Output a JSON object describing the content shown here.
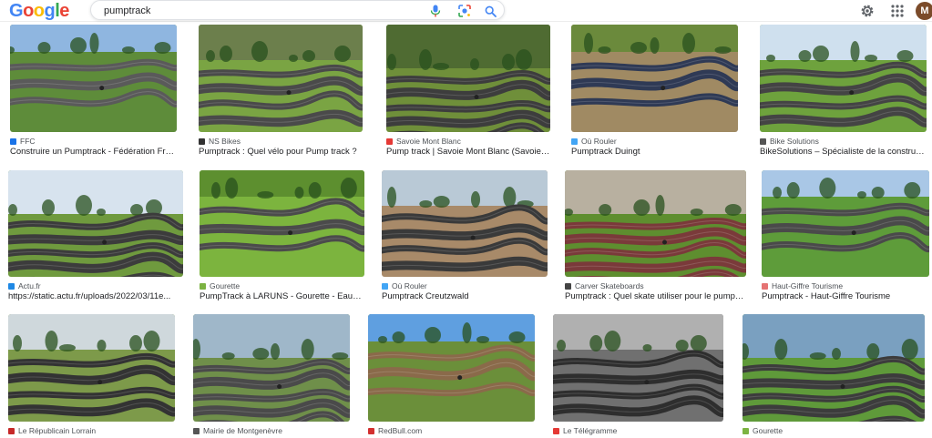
{
  "header": {
    "logo_letters": [
      {
        "char": "G",
        "color": "#4285F4"
      },
      {
        "char": "o",
        "color": "#EA4335"
      },
      {
        "char": "o",
        "color": "#FBBC05"
      },
      {
        "char": "g",
        "color": "#4285F4"
      },
      {
        "char": "l",
        "color": "#34A853"
      },
      {
        "char": "e",
        "color": "#EA4335"
      }
    ],
    "search_value": "pumptrack",
    "avatar_letter": "M",
    "icons": [
      "mic-icon",
      "lens-icon",
      "search-icon",
      "settings-icon",
      "apps-icon"
    ]
  },
  "results": [
    {
      "source": "FFC",
      "title": "Construire un Pumptrack - Fédération Fran...",
      "favicon": "#1a73e8",
      "sky": "#8fb6e0",
      "ground": "#5e8c3a",
      "track": "#5a5a5a"
    },
    {
      "source": "NS Bikes",
      "title": "Pumptrack : Quel vélo pour Pump track ?",
      "favicon": "#333333",
      "sky": "#6c7f4c",
      "ground": "#7aa443",
      "track": "#4a4a4a"
    },
    {
      "source": "Savoie Mont Blanc",
      "title": "Pump track | Savoie Mont Blanc (Savoie et ...",
      "favicon": "#e53935",
      "sky": "#4f6b32",
      "ground": "#6f8f3a",
      "track": "#3d3d3d"
    },
    {
      "source": "Où Rouler",
      "title": "Pumptrack Duingt",
      "favicon": "#42a5f5",
      "sky": "#6b8a3c",
      "ground": "#a08a63",
      "track": "#2f3a55"
    },
    {
      "source": "Bike Solutions",
      "title": "BikeSolutions – Spécialiste de la constructi...",
      "favicon": "#555555",
      "sky": "#cfe0ee",
      "ground": "#6ea23d",
      "track": "#444444"
    },
    {
      "source": "Actu.fr",
      "title": "https://static.actu.fr/uploads/2022/03/11e...",
      "favicon": "#1e88e5",
      "sky": "#d7e3ee",
      "ground": "#6f9a3e",
      "track": "#3c3c3c"
    },
    {
      "source": "Gourette",
      "title": "PumpTrack à LARUNS - Gourette - Eaux-B...",
      "favicon": "#7cb342",
      "sky": "#5d8f2f",
      "ground": "#7cb43e",
      "track": "#4b4b4b"
    },
    {
      "source": "Où Rouler",
      "title": "Pumptrack Creutzwald",
      "favicon": "#42a5f5",
      "sky": "#b9c9d6",
      "ground": "#a88a69",
      "track": "#3a3a3a"
    },
    {
      "source": "Carver Skateboards",
      "title": "Pumptrack : Quel skate utiliser pour le pump t...",
      "favicon": "#444444",
      "sky": "#b8b0a0",
      "ground": "#5e8e2f",
      "track": "#7a3a3a"
    },
    {
      "source": "Haut-Giffre Tourisme",
      "title": "Pumptrack - Haut-Giffre Tourisme",
      "favicon": "#e57373",
      "sky": "#a9c7e6",
      "ground": "#5e9c3a",
      "track": "#4a4a4a"
    },
    {
      "source": "Le Républicain Lorrain",
      "title": "",
      "favicon": "#c62828",
      "sky": "#cfd8dc",
      "ground": "#7d9a4a",
      "track": "#333333"
    },
    {
      "source": "Mairie de Montgenèvre",
      "title": "",
      "favicon": "#555555",
      "sky": "#9fb7c9",
      "ground": "#6f8f4a",
      "track": "#4a4a4a"
    },
    {
      "source": "RedBull.com",
      "title": "",
      "favicon": "#d32f2f",
      "sky": "#5f9fe0",
      "ground": "#6b8f3a",
      "track": "#8a6a4a"
    },
    {
      "source": "Le Télégramme",
      "title": "",
      "favicon": "#e53935",
      "sky": "#b0b0b0",
      "ground": "#707070",
      "track": "#2e2e2e"
    },
    {
      "source": "Gourette",
      "title": "",
      "favicon": "#7cb342",
      "sky": "#7aa0c0",
      "ground": "#5f9a3a",
      "track": "#3c3c3c"
    }
  ]
}
